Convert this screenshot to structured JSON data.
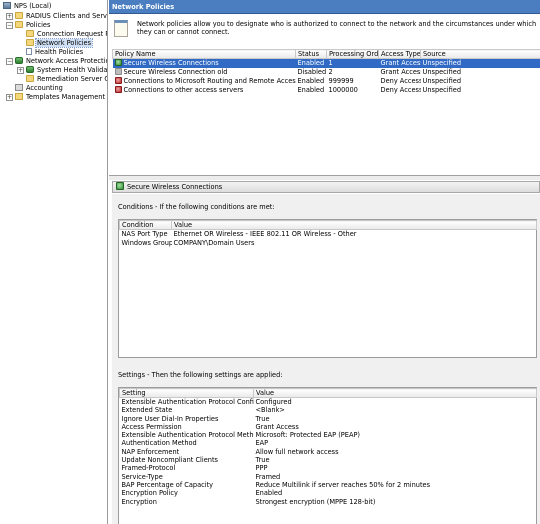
{
  "tree": {
    "items": [
      {
        "label": "NPS (Local)",
        "icon": "server-icon",
        "expander": ""
      },
      {
        "label": "RADIUS Clients and Servers",
        "icon": "folder-icon",
        "expander": "+"
      },
      {
        "label": "Policies",
        "icon": "folder-icon",
        "expander": "−"
      },
      {
        "label": "Connection Request Polici",
        "icon": "folder-icon",
        "expander": ""
      },
      {
        "label": "Network Policies",
        "icon": "folder-icon",
        "expander": ""
      },
      {
        "label": "Health Policies",
        "icon": "page-icon",
        "expander": ""
      },
      {
        "label": "Network Access Protection",
        "icon": "nap-icon",
        "expander": "−"
      },
      {
        "label": "System Health Validators",
        "icon": "nap-icon",
        "expander": "+"
      },
      {
        "label": "Remediation Server Group",
        "icon": "folder-icon",
        "expander": ""
      },
      {
        "label": "Accounting",
        "icon": "accounting-icon",
        "expander": ""
      },
      {
        "label": "Templates Management",
        "icon": "templates-icon",
        "expander": "+"
      }
    ]
  },
  "header": {
    "title": "Network Policies"
  },
  "info": {
    "text": "Network policies allow you to designate who is authorized to connect to the network and the circumstances under which they can or cannot connect."
  },
  "policies": {
    "columns": [
      "Policy Name",
      "Status",
      "Processing Order",
      "Access Type",
      "Source"
    ],
    "rows": [
      {
        "name": "Secure Wireless Connections",
        "status": "Enabled",
        "order": "1",
        "access": "Grant Access",
        "source": "Unspecified",
        "icon": "grant"
      },
      {
        "name": "Secure Wireless Connection old",
        "status": "Disabled",
        "order": "2",
        "access": "Grant Access",
        "source": "Unspecified",
        "icon": "disabled"
      },
      {
        "name": "Connections to Microsoft Routing and Remote Access server",
        "status": "Enabled",
        "order": "999999",
        "access": "Deny Access",
        "source": "Unspecified",
        "icon": "deny"
      },
      {
        "name": "Connections to other access servers",
        "status": "Enabled",
        "order": "1000000",
        "access": "Deny Access",
        "source": "Unspecified",
        "icon": "deny"
      }
    ]
  },
  "detail": {
    "title": "Secure Wireless Connections",
    "conditions_label": "Conditions - If the following conditions are met:",
    "conditions_columns": [
      "Condition",
      "Value"
    ],
    "conditions": [
      {
        "condition": "NAS Port Type",
        "value": "Ethernet OR Wireless - IEEE 802.11 OR Wireless - Other"
      },
      {
        "condition": "Windows Groups",
        "value": "COMPANY\\Domain Users"
      }
    ],
    "settings_label": "Settings - Then the following settings are applied:",
    "settings_columns": [
      "Setting",
      "Value"
    ],
    "settings": [
      {
        "setting": "Extensible Authentication Protocol Configuration",
        "value": "Configured"
      },
      {
        "setting": "Extended State",
        "value": "<Blank>"
      },
      {
        "setting": "Ignore User Dial-In Properties",
        "value": "True"
      },
      {
        "setting": "Access Permission",
        "value": "Grant Access"
      },
      {
        "setting": "Extensible Authentication Protocol Method",
        "value": "Microsoft: Protected EAP (PEAP)"
      },
      {
        "setting": "Authentication Method",
        "value": "EAP"
      },
      {
        "setting": "NAP Enforcement",
        "value": "Allow full network access"
      },
      {
        "setting": "Update Noncompliant Clients",
        "value": "True"
      },
      {
        "setting": "Framed-Protocol",
        "value": "PPP"
      },
      {
        "setting": "Service-Type",
        "value": "Framed"
      },
      {
        "setting": "BAP Percentage of Capacity",
        "value": "Reduce Multilink if server reaches 50% for 2 minutes"
      },
      {
        "setting": "Encryption Policy",
        "value": "Enabled"
      },
      {
        "setting": "Encryption",
        "value": "Strongest encryption (MPPE 128-bit)"
      }
    ]
  }
}
